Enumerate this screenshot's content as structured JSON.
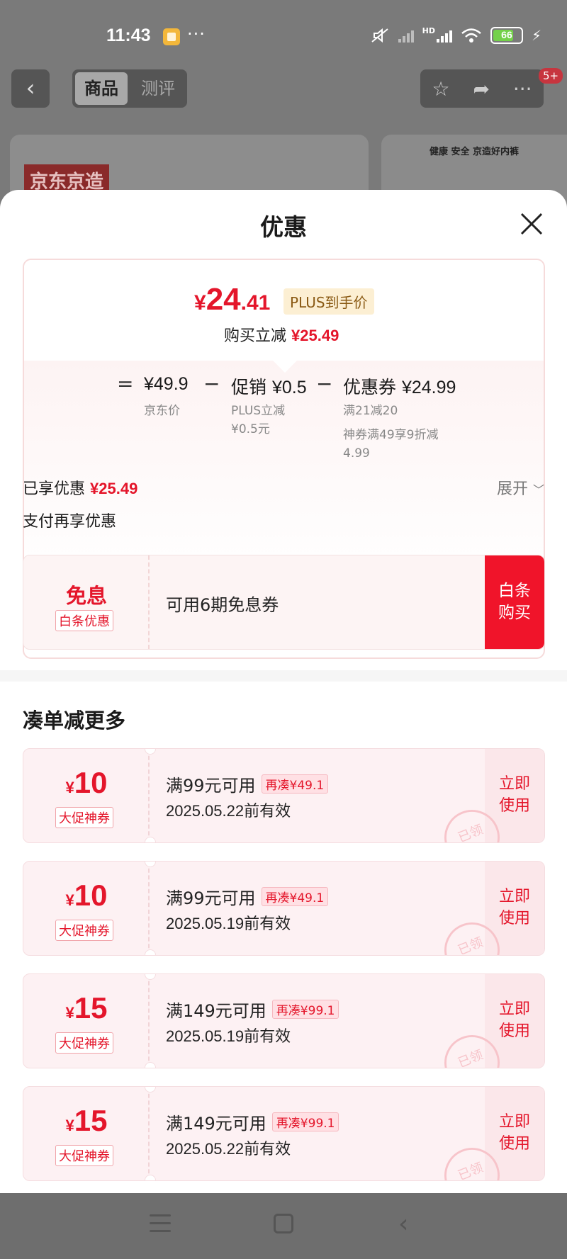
{
  "status_bar": {
    "time": "11:43",
    "dots": "···",
    "network": "HD",
    "battery": "66"
  },
  "background": {
    "tabs": [
      "商品",
      "测评"
    ],
    "back_icon": "‹",
    "badge": "5+",
    "brand_logo": "京东京造",
    "banner_text": "健康 安全 京造好内裤"
  },
  "sheet": {
    "title": "优惠",
    "price": {
      "currency": "¥",
      "integer": "24",
      "decimal": ".41",
      "plus_tag": "PLUS到手价",
      "buy_off_label": "购买立减",
      "buy_off_value": "¥25.49"
    },
    "breakdown": {
      "equals": "=",
      "minus": "−",
      "terms": [
        {
          "label": "",
          "value": "¥49.9",
          "sub": [
            "京东价"
          ]
        },
        {
          "label": "促销",
          "value": "¥0.5",
          "sub": [
            "PLUS立减",
            "¥0.5元"
          ]
        },
        {
          "label": "优惠券",
          "value": "¥24.99",
          "sub": [
            "满21减20",
            "神券满49享9折减",
            "4.99"
          ]
        }
      ]
    },
    "enjoyed_label": "已享优惠",
    "enjoyed_value": "¥25.49",
    "expand_label": "展开",
    "pay_more_label": "支付再享优惠",
    "baitiao": {
      "title": "免息",
      "tag": "白条优惠",
      "desc": "可用6期免息券",
      "button": [
        "白条",
        "购买"
      ]
    },
    "more_title": "凑单减更多",
    "coupons": [
      {
        "currency": "¥",
        "amount": "10",
        "tag": "大促神券",
        "condition": "满99元可用",
        "extra": "再凑¥49.1",
        "date": "2025.05.22前有效",
        "button": [
          "立即",
          "使用"
        ],
        "stamp": "已领"
      },
      {
        "currency": "¥",
        "amount": "10",
        "tag": "大促神券",
        "condition": "满99元可用",
        "extra": "再凑¥49.1",
        "date": "2025.05.19前有效",
        "button": [
          "立即",
          "使用"
        ],
        "stamp": "已领"
      },
      {
        "currency": "¥",
        "amount": "15",
        "tag": "大促神券",
        "condition": "满149元可用",
        "extra": "再凑¥99.1",
        "date": "2025.05.19前有效",
        "button": [
          "立即",
          "使用"
        ],
        "stamp": "已领"
      },
      {
        "currency": "¥",
        "amount": "15",
        "tag": "大促神券",
        "condition": "满149元可用",
        "extra": "再凑¥99.1",
        "date": "2025.05.22前有效",
        "button": [
          "立即",
          "使用"
        ],
        "stamp": "已领"
      }
    ]
  },
  "colors": {
    "accent_red": "#e4162b",
    "button_red": "#f0142a",
    "plus_gold_bg": "#fcefd3"
  }
}
